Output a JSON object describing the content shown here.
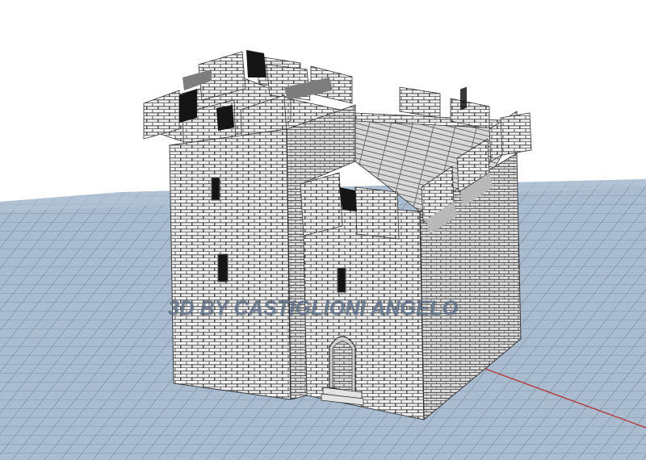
{
  "watermark": {
    "text": "3D BY CASTIGLIONI ANGELO"
  },
  "scene": {
    "subject": "stone-castle-keep-model",
    "colors": {
      "background": "#ffffff",
      "ground_grid": "#a9bcd0",
      "ground_lines": "#4f6076",
      "axis_line": "#b33a3a",
      "stone_light": "#efefef",
      "stone_mid": "#d6d6d6",
      "stone_shadow": "#9b9b9b",
      "mortar": "#3a3a3a",
      "opening": "#151515",
      "watermark": "#5f7189"
    }
  }
}
